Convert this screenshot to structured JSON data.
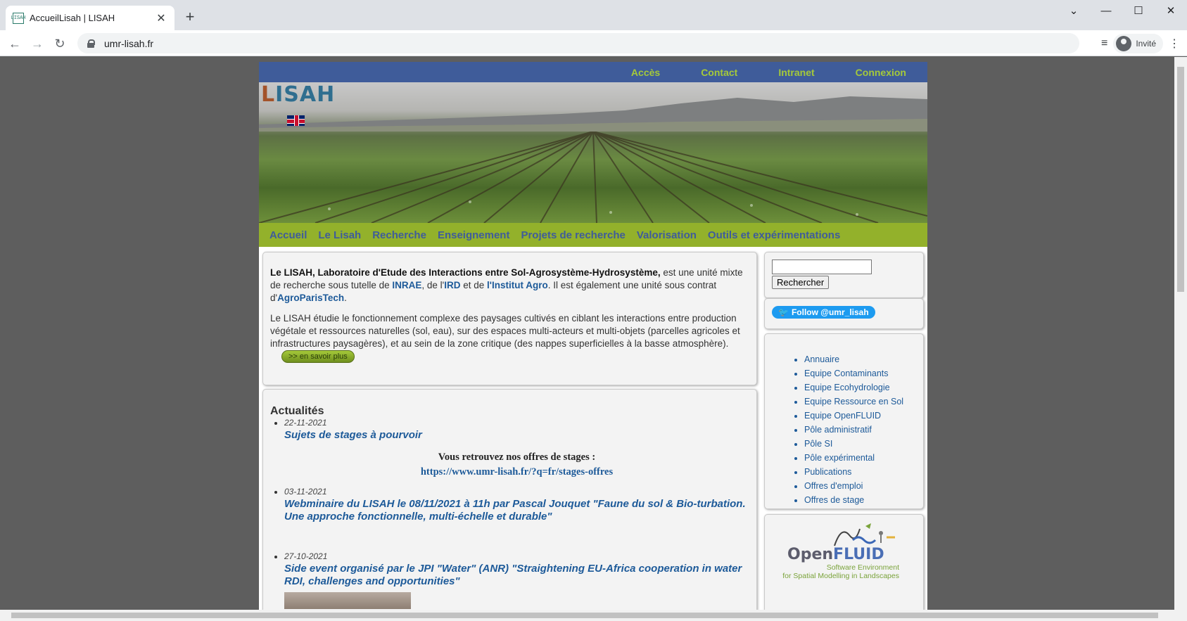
{
  "browser": {
    "tab_title": "AccueilLisah | LISAH",
    "tab_favicon": "LISAH",
    "url": "umr-lisah.fr",
    "profile_label": "Invité"
  },
  "site": {
    "topnav": [
      "Accès",
      "Contact",
      "Intranet",
      "Connexion"
    ],
    "logo": {
      "part1": "L",
      "part2": "ISAH"
    },
    "mainnav": [
      "Accueil",
      "Le Lisah",
      "Recherche",
      "Enseignement",
      "Projets de recherche",
      "Valorisation",
      "Outils et expérimentations"
    ],
    "intro": {
      "p1_bold": "Le LISAH, Laboratoire d'Etude des Interactions entre Sol-Agrosystème-Hydrosystème,",
      "p1_a": " est une unité mixte de recherche sous tutelle de ",
      "inrae": "INRAE",
      "p1_b": ", de l'",
      "ird": "IRD",
      "p1_c": " et de ",
      "institut_agro": "l'Institut Agro",
      "p1_d": ". Il est également une unité sous contrat d'",
      "agroparistech": "AgroParisTech",
      "p1_e": ".",
      "p2": "Le LISAH étudie le fonctionnement complexe des paysages cultivés en ciblant les interactions entre production végétale et ressources naturelles (sol, eau), sur des espaces multi-acteurs et multi-objets (parcelles agricoles et infrastructures paysagères), et au sein de la zone critique (des nappes superficielles à la basse atmosphère).",
      "more_label": ">> en savoir plus"
    },
    "news": {
      "heading": "Actualités",
      "items": [
        {
          "date": "22-11-2021",
          "title": "Sujets de stages à pourvoir",
          "body1": "Vous  retrouvez nos offres de stages :",
          "body2": "https://www.umr-lisah.fr/?q=fr/stages-offres"
        },
        {
          "date": "03-11-2021",
          "title": "Webminaire du LISAH le 08/11/2021 à 11h par Pascal Jouquet \"Faune du sol & Bio-turbation. Une approche fonctionnelle, multi-échelle et durable\""
        },
        {
          "date": "27-10-2021",
          "title": "Side event organisé par le JPI \"Water\" (ANR) \"Straightening EU-Africa cooperation in water RDI, challenges and opportunities\""
        }
      ]
    },
    "sidebar": {
      "search_button": "Rechercher",
      "twitter_follow": "Follow @umr_lisah",
      "links": [
        "Annuaire",
        "Equipe Contaminants",
        "Equipe Ecohydrologie",
        "Equipe Ressource en Sol",
        "Equipe OpenFLUID",
        "Pôle administratif",
        "Pôle SI",
        "Pôle expérimental",
        "Publications",
        "Offres d'emploi",
        "Offres de stage"
      ],
      "openfluid": {
        "name_a": "Open",
        "name_b": "FLUID",
        "sub1": "Software Environment",
        "sub2": "for Spatial Modelling in Landscapes"
      }
    }
  }
}
